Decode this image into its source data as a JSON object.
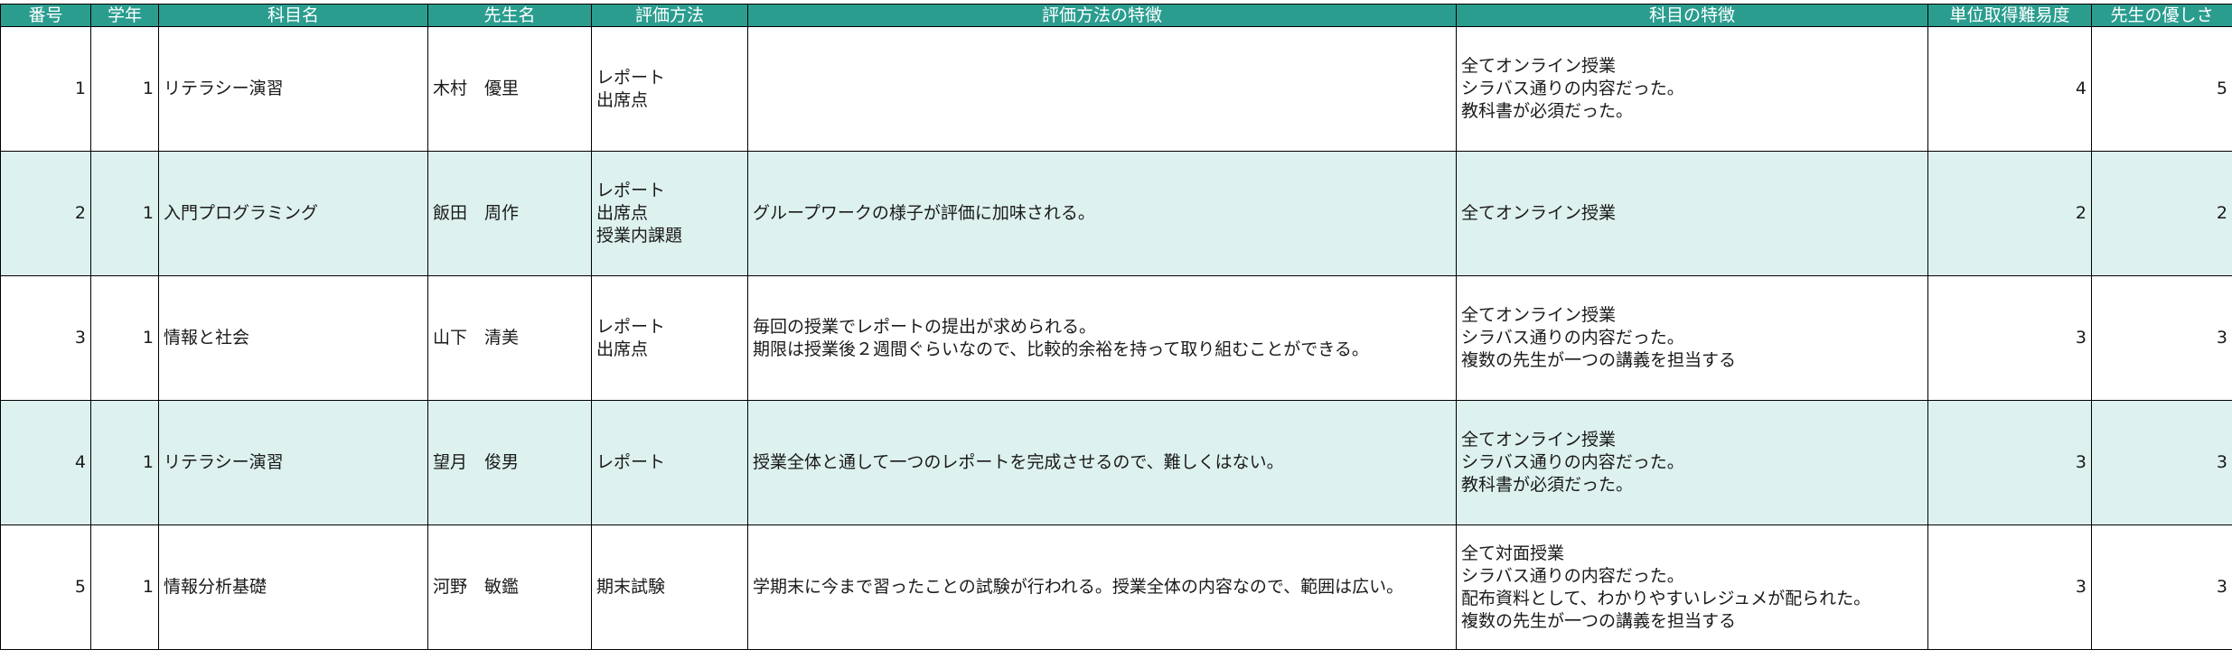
{
  "table": {
    "headers": [
      "番号",
      "学年",
      "科目名",
      "先生名",
      "評価方法",
      "評価方法の特徴",
      "科目の特徴",
      "単位取得難易度",
      "先生の優しさ"
    ],
    "rows": [
      {
        "no": "1",
        "grade": "1",
        "subject": "リテラシー演習",
        "teacher": "木村　優里",
        "method": "レポート\n出席点",
        "method_note": "",
        "subject_note": "全てオンライン授業\nシラバス通りの内容だった。\n教科書が必須だった。",
        "difficulty": "4",
        "kindness": "5"
      },
      {
        "no": "2",
        "grade": "1",
        "subject": "入門プログラミング",
        "teacher": "飯田　周作",
        "method": "レポート\n出席点\n授業内課題",
        "method_note": "グループワークの様子が評価に加味される。",
        "subject_note": "全てオンライン授業",
        "difficulty": "2",
        "kindness": "2"
      },
      {
        "no": "3",
        "grade": "1",
        "subject": "情報と社会",
        "teacher": "山下　清美",
        "method": "レポート\n出席点",
        "method_note": "毎回の授業でレポートの提出が求められる。\n期限は授業後２週間ぐらいなので、比較的余裕を持って取り組むことができる。",
        "subject_note": "全てオンライン授業\nシラバス通りの内容だった。\n複数の先生が一つの講義を担当する",
        "difficulty": "3",
        "kindness": "3"
      },
      {
        "no": "4",
        "grade": "1",
        "subject": "リテラシー演習",
        "teacher": "望月　俊男",
        "method": "レポート",
        "method_note": "授業全体と通して一つのレポートを完成させるので、難しくはない。",
        "subject_note": "全てオンライン授業\nシラバス通りの内容だった。\n教科書が必須だった。",
        "difficulty": "3",
        "kindness": "3"
      },
      {
        "no": "5",
        "grade": "1",
        "subject": "情報分析基礎",
        "teacher": "河野　敏鑑",
        "method": "期末試験",
        "method_note": "学期末に今まで習ったことの試験が行われる。授業全体の内容なので、範囲は広い。",
        "subject_note": "全て対面授業\nシラバス通りの内容だった。\n配布資料として、わかりやすいレジュメが配られた。\n複数の先生が一つの講義を担当する",
        "difficulty": "3",
        "kindness": "3"
      }
    ]
  },
  "colors": {
    "header_bg": "#2a9d8f",
    "header_text": "#ffffff",
    "alt_row_bg": "#ddf1ef",
    "grid": "#000000"
  }
}
